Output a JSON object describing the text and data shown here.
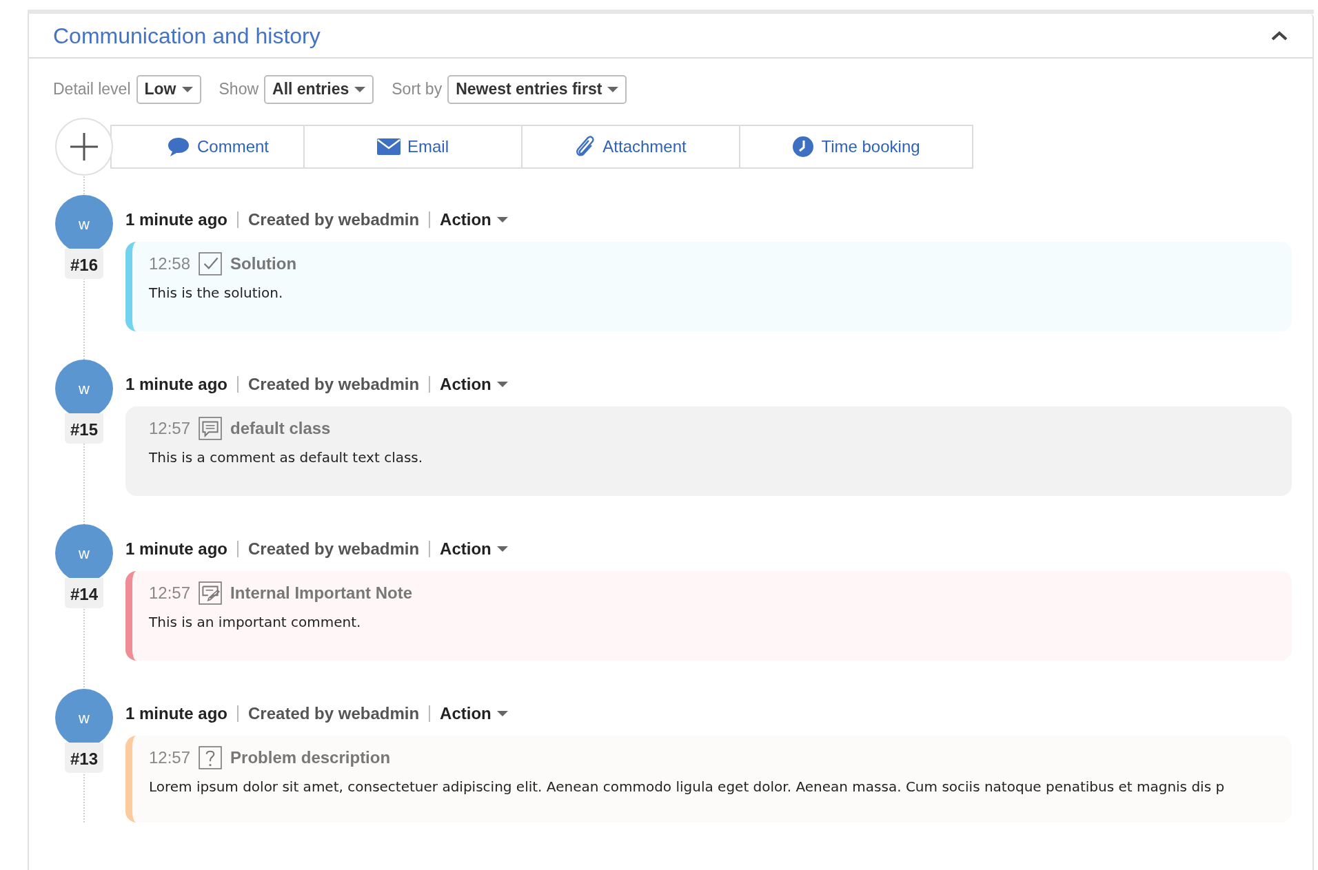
{
  "panel": {
    "title": "Communication and history",
    "expanded": true
  },
  "filters": [
    {
      "label": "Detail level",
      "value": "Low"
    },
    {
      "label": "Show",
      "value": "All entries"
    },
    {
      "label": "Sort by",
      "value": "Newest entries first"
    }
  ],
  "add_tabs": [
    {
      "kind": "comment",
      "label": "Comment"
    },
    {
      "kind": "email",
      "label": "Email"
    },
    {
      "kind": "attachment",
      "label": "Attachment"
    },
    {
      "kind": "time",
      "label": "Time booking"
    }
  ],
  "entries": [
    {
      "avatar": "w",
      "number": "#16",
      "ago": "1 minute ago",
      "creator": "Created by webadmin",
      "action": "Action",
      "time": "12:58",
      "kind": "solution",
      "title": "Solution",
      "text": "This is the solution."
    },
    {
      "avatar": "w",
      "number": "#15",
      "ago": "1 minute ago",
      "creator": "Created by webadmin",
      "action": "Action",
      "time": "12:57",
      "kind": "default",
      "title": "default class",
      "text": "This is a comment as default text class."
    },
    {
      "avatar": "w",
      "number": "#14",
      "ago": "1 minute ago",
      "creator": "Created by webadmin",
      "action": "Action",
      "time": "12:57",
      "kind": "important",
      "title": "Internal Important Note",
      "text": "This is an important comment."
    },
    {
      "avatar": "w",
      "number": "#13",
      "ago": "1 minute ago",
      "creator": "Created by webadmin",
      "action": "Action",
      "time": "12:57",
      "kind": "problem",
      "title": "Problem description",
      "text": "Lorem ipsum dolor sit amet, consectetuer adipiscing elit. Aenean commodo ligula eget dolor. Aenean massa. Cum sociis natoque penatibus et magnis dis p"
    }
  ]
}
